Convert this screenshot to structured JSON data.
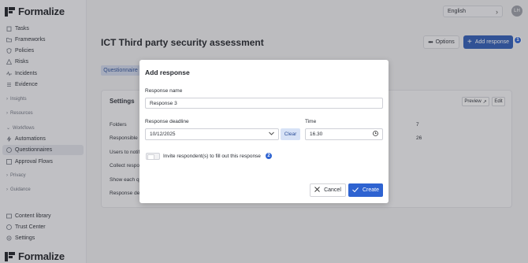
{
  "app": {
    "logo_text": "Formalize"
  },
  "sidebar": {
    "top_items": [
      {
        "label": "Tasks",
        "icon": "clipboard-icon"
      },
      {
        "label": "Frameworks",
        "icon": "folder-icon"
      },
      {
        "label": "Policies",
        "icon": "shield-icon"
      },
      {
        "label": "Risks",
        "icon": "warning-icon"
      },
      {
        "label": "Incidents",
        "icon": "pulse-icon"
      },
      {
        "label": "Evidence",
        "icon": "list-icon"
      }
    ],
    "groups": {
      "insights": "Insights",
      "resources": "Resources",
      "workflows": "Workflows",
      "privacy": "Privacy",
      "guidance": "Guidance"
    },
    "workflow_items": [
      {
        "label": "Automations",
        "icon": "bolt-icon"
      },
      {
        "label": "Questionnaires",
        "icon": "question-icon",
        "active": true
      },
      {
        "label": "Approval Flows",
        "icon": "flow-icon"
      }
    ],
    "bottom_items": [
      {
        "label": "Content library",
        "icon": "library-icon"
      },
      {
        "label": "Trust Center",
        "icon": "check-circle-icon"
      },
      {
        "label": "Settings",
        "icon": "gear-icon"
      }
    ]
  },
  "topbar": {
    "language": "English",
    "avatar_initials": "LH"
  },
  "page": {
    "title": "ICT Third party security assessment",
    "options_label": "Options",
    "add_response_label": "Add response",
    "badge_1": "1",
    "tab_label": "Questionnaire"
  },
  "settings": {
    "title": "Settings",
    "preview_label": "Preview",
    "edit_label": "Edit",
    "rows": [
      "Folders",
      "Responsible",
      "Users to notif",
      "Collect respon",
      "Show each qu",
      "Response dea"
    ],
    "values": [
      "7",
      "26"
    ]
  },
  "modal": {
    "title": "Add response",
    "name_label": "Response name",
    "name_value": "Response 3",
    "deadline_label": "Response deadline",
    "deadline_value": "10/12/2025",
    "clear_label": "Clear",
    "time_label": "Time",
    "time_value": "16.30",
    "invite_label": "Invite respondent(s) to fill out this response",
    "badge_2": "2",
    "cancel_label": "Cancel",
    "create_label": "Create"
  },
  "colors": {
    "primary": "#2e63d1",
    "active_nav": "#dfe1e8",
    "badge": "#2e63d1"
  }
}
